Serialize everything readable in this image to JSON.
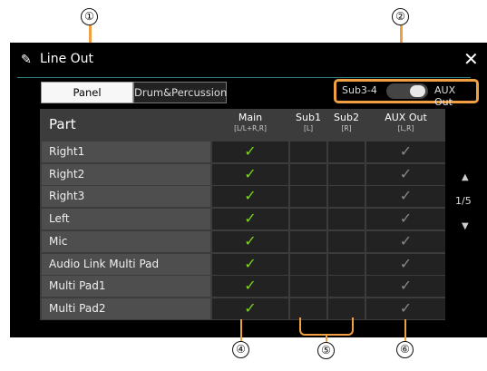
{
  "callouts": [
    "①",
    "②",
    "④",
    "⑤",
    "⑥"
  ],
  "window": {
    "title": "Line Out",
    "close_glyph": "✕"
  },
  "tabs": [
    {
      "label": "Panel",
      "selected": true
    },
    {
      "label": "Drum&Percussion",
      "selected": false
    }
  ],
  "mode": {
    "left_label": "Sub3-4",
    "right_label": "AUX Out",
    "value": "AUX Out"
  },
  "table": {
    "part_header": "Part",
    "columns": [
      {
        "name": "Main",
        "sub": "[L/L+R,R]"
      },
      {
        "name": "Sub1",
        "sub": "[L]"
      },
      {
        "name": "Sub2",
        "sub": "[R]"
      },
      {
        "name": "AUX Out",
        "sub": "[L,R]"
      }
    ],
    "rows": [
      {
        "part": "Right1",
        "checks": [
          "on",
          "",
          "",
          "off"
        ]
      },
      {
        "part": "Right2",
        "checks": [
          "on",
          "",
          "",
          "off"
        ]
      },
      {
        "part": "Right3",
        "checks": [
          "on",
          "",
          "",
          "off"
        ]
      },
      {
        "part": "Left",
        "checks": [
          "on",
          "",
          "",
          "off"
        ]
      },
      {
        "part": "Mic",
        "checks": [
          "on",
          "",
          "",
          "off"
        ]
      },
      {
        "part": "Audio Link Multi Pad",
        "checks": [
          "on",
          "",
          "",
          "off"
        ]
      },
      {
        "part": "Multi Pad1",
        "checks": [
          "on",
          "",
          "",
          "off"
        ]
      },
      {
        "part": "Multi Pad2",
        "checks": [
          "on",
          "",
          "",
          "off"
        ]
      }
    ]
  },
  "pager": {
    "page": "1/5",
    "up": "▲",
    "down": "▼"
  },
  "icons": {
    "title": "pencil-icon",
    "close": "close-icon",
    "check": "check-icon"
  },
  "colors": {
    "accent": "#f0a040",
    "check_on": "#7ed321",
    "check_off": "#888888"
  }
}
